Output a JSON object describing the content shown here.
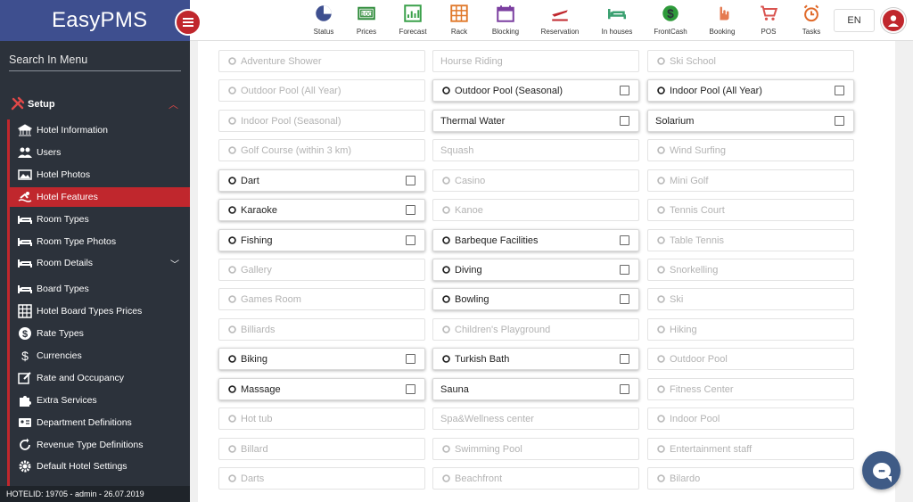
{
  "app": {
    "brand": "EasyPMS",
    "language": "EN"
  },
  "colors": {
    "sidebar_bg": "#2c323b",
    "brand_bg": "#3e4f8f",
    "accent": "#c0272d",
    "chat": "#3f5b86"
  },
  "sidebar": {
    "search_label": "Search In Menu",
    "section": {
      "label": "Setup",
      "icon": "tools-icon"
    },
    "items": [
      {
        "label": "Hotel Information",
        "icon": "bank-icon"
      },
      {
        "label": "Users",
        "icon": "users-icon"
      },
      {
        "label": "Hotel Photos",
        "icon": "image-icon"
      },
      {
        "label": "Hotel Features",
        "icon": "swimmer-icon",
        "active": true
      },
      {
        "label": "Room Types",
        "icon": "bed-icon"
      },
      {
        "label": "Room Type Photos",
        "icon": "bed-icon"
      },
      {
        "label": "Room Details",
        "icon": "bed-icon",
        "caret": true
      },
      {
        "label": "Board Types",
        "icon": "bed-icon"
      },
      {
        "label": "Hotel Board Types Prices",
        "icon": "grid-icon"
      },
      {
        "label": "Rate Types",
        "icon": "dollar-circle-icon"
      },
      {
        "label": "Currencies",
        "icon": "dollar-icon"
      },
      {
        "label": "Rate and Occupancy",
        "icon": "edit-icon"
      },
      {
        "label": "Extra Services",
        "icon": "puzzle-icon"
      },
      {
        "label": "Department Definitions",
        "icon": "id-card-icon"
      },
      {
        "label": "Revenue Type Definitions",
        "icon": "refresh-icon"
      },
      {
        "label": "Default Hotel Settings",
        "icon": "gear-icon"
      }
    ],
    "footer": "HOTELID: 19705 - admin - 26.07.2019"
  },
  "toolbar": [
    {
      "label": "Status",
      "icon": "pie-chart-icon",
      "color": "#3e4f8f"
    },
    {
      "label": "Prices",
      "icon": "money-icon",
      "color": "#2e8b3a"
    },
    {
      "label": "Forecast",
      "icon": "chart-icon",
      "color": "#3aa04a"
    },
    {
      "label": "Rack",
      "icon": "grid-icon",
      "color": "#e0782a"
    },
    {
      "label": "Blocking",
      "icon": "calendar-icon",
      "color": "#7b3fa0"
    },
    {
      "label": "Reservation",
      "icon": "plane-icon",
      "color": "#c0272d"
    },
    {
      "label": "In houses",
      "icon": "bed-icon",
      "color": "#3aa070"
    },
    {
      "label": "FrontCash",
      "icon": "dollar-circle-icon",
      "color": "#2e9a3a"
    },
    {
      "label": "Booking",
      "icon": "hand-icon",
      "color": "#e57a50"
    },
    {
      "label": "POS",
      "icon": "cart-icon",
      "color": "#d9534f"
    },
    {
      "label": "Tasks",
      "icon": "alarm-icon",
      "color": "#e06a2a"
    }
  ],
  "features": [
    [
      {
        "label": "Adventure Shower",
        "checkable": false,
        "icon": "shower-icon"
      },
      {
        "label": "Outdoor Pool (All Year)",
        "checkable": false,
        "icon": "pool-icon"
      },
      {
        "label": "Indoor Pool (Seasonal)",
        "checkable": false,
        "icon": "pool-icon"
      },
      {
        "label": "Golf Course (within 3 km)",
        "checkable": false,
        "icon": "golf-icon"
      },
      {
        "label": "Dart",
        "checkable": true,
        "icon": "dart-icon"
      },
      {
        "label": "Karaoke",
        "checkable": true,
        "icon": "mic-icon"
      },
      {
        "label": "Fishing",
        "checkable": true,
        "icon": "fishing-icon"
      },
      {
        "label": "Gallery",
        "checkable": false,
        "icon": "gallery-icon"
      },
      {
        "label": "Games Room",
        "checkable": false,
        "icon": "puzzle-icon"
      },
      {
        "label": "Billiards",
        "checkable": false,
        "icon": "ball-icon"
      },
      {
        "label": "Biking",
        "checkable": true,
        "icon": "bike-icon"
      },
      {
        "label": "Massage",
        "checkable": true,
        "icon": "lotus-icon"
      },
      {
        "label": "Hot tub",
        "checkable": false,
        "icon": "tub-icon"
      },
      {
        "label": "Billard",
        "checkable": false,
        "icon": "ball-icon"
      },
      {
        "label": "Darts",
        "checkable": false,
        "icon": "dart-icon"
      }
    ],
    [
      {
        "label": "Hourse Riding",
        "checkable": false,
        "icon": ""
      },
      {
        "label": "Outdoor Pool (Seasonal)",
        "checkable": true,
        "icon": "pool-icon"
      },
      {
        "label": "Thermal Water",
        "checkable": true,
        "icon": ""
      },
      {
        "label": "Squash",
        "checkable": false,
        "icon": ""
      },
      {
        "label": "Casino",
        "checkable": false,
        "icon": "dice-icon"
      },
      {
        "label": "Kanoe",
        "checkable": false,
        "icon": "kanoe-icon"
      },
      {
        "label": "Barbeque Facilities",
        "checkable": true,
        "icon": "bbq-icon"
      },
      {
        "label": "Diving",
        "checkable": true,
        "icon": "diving-icon"
      },
      {
        "label": "Bowling",
        "checkable": true,
        "icon": "bowling-icon"
      },
      {
        "label": "Children's Playground",
        "checkable": false,
        "icon": "gamepad-icon"
      },
      {
        "label": "Turkish Bath",
        "checkable": true,
        "icon": "bath-icon"
      },
      {
        "label": "Sauna",
        "checkable": true,
        "icon": ""
      },
      {
        "label": "Spa&Wellness center",
        "checkable": false,
        "icon": ""
      },
      {
        "label": "Swimming Pool",
        "checkable": false,
        "icon": "pool-icon"
      },
      {
        "label": "Beachfront",
        "checkable": false,
        "icon": "beach-icon"
      }
    ],
    [
      {
        "label": "Ski School",
        "checkable": false,
        "icon": "ski-icon"
      },
      {
        "label": "Indoor Pool (All Year)",
        "checkable": true,
        "icon": "pool-icon"
      },
      {
        "label": "Solarium",
        "checkable": true,
        "icon": ""
      },
      {
        "label": "Wind Surfing",
        "checkable": false,
        "icon": "wind-icon"
      },
      {
        "label": "Mini Golf",
        "checkable": false,
        "icon": "golf-icon"
      },
      {
        "label": "Tennis Court",
        "checkable": false,
        "icon": "tennis-icon"
      },
      {
        "label": "Table Tennis",
        "checkable": false,
        "icon": "pingpong-icon"
      },
      {
        "label": "Snorkelling",
        "checkable": false,
        "icon": "snorkel-icon"
      },
      {
        "label": "Ski",
        "checkable": false,
        "icon": "ski-icon"
      },
      {
        "label": "Hiking",
        "checkable": false,
        "icon": "tree-icon"
      },
      {
        "label": "Outdoor Pool",
        "checkable": false,
        "icon": "pool-icon"
      },
      {
        "label": "Fitness Center",
        "checkable": false,
        "icon": "dumbbell-icon"
      },
      {
        "label": "Indoor Pool",
        "checkable": false,
        "icon": "pool-icon"
      },
      {
        "label": "Entertainment staff",
        "checkable": false,
        "icon": "people-icon"
      },
      {
        "label": "Bilardo",
        "checkable": false,
        "icon": "ball-icon"
      }
    ]
  ]
}
